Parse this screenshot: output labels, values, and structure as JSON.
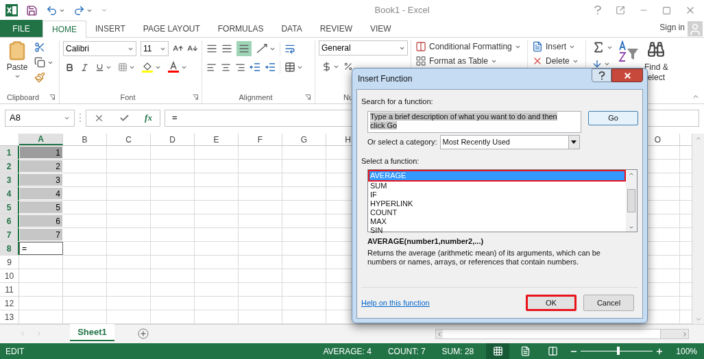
{
  "window": {
    "title": "Book1 - Excel"
  },
  "ribbon_tabs": [
    {
      "label": "FILE",
      "kind": "file",
      "selected": false
    },
    {
      "label": "HOME",
      "kind": "tab",
      "selected": true
    },
    {
      "label": "INSERT",
      "kind": "tab",
      "selected": false
    },
    {
      "label": "PAGE LAYOUT",
      "kind": "tab",
      "selected": false
    },
    {
      "label": "FORMULAS",
      "kind": "tab",
      "selected": false
    },
    {
      "label": "DATA",
      "kind": "tab",
      "selected": false
    },
    {
      "label": "REVIEW",
      "kind": "tab",
      "selected": false
    },
    {
      "label": "VIEW",
      "kind": "tab",
      "selected": false
    }
  ],
  "sign_in": "Sign in",
  "ribbon": {
    "paste": "Paste",
    "font_name": "Calibri",
    "font_size": "11",
    "number_format": "General",
    "conditional_formatting": "Conditional Formatting",
    "format_as_table": "Format as Table",
    "insert": "Insert",
    "delete": "Delete",
    "find_select_line_1": "Find &",
    "find_select_line_2": "elect",
    "group_labels": [
      "Clipboard",
      "Font",
      "Alignment",
      "Nu"
    ]
  },
  "formula_bar": {
    "name_box": "A8",
    "function_label": "fx",
    "formula": "="
  },
  "sheet": {
    "columns": [
      {
        "label": "A",
        "selected": true
      },
      {
        "label": "B",
        "selected": false
      },
      {
        "label": "C",
        "selected": false
      },
      {
        "label": "D",
        "selected": false
      },
      {
        "label": "E",
        "selected": false
      },
      {
        "label": "F",
        "selected": false
      },
      {
        "label": "G",
        "selected": false
      },
      {
        "label": "H",
        "selected": false
      }
    ],
    "last_column": {
      "label": "O"
    },
    "rows": [
      {
        "label": "1",
        "selected": true,
        "in_range": true,
        "range_anchor": true,
        "active": false,
        "cell": "1"
      },
      {
        "label": "2",
        "selected": true,
        "in_range": true,
        "range_anchor": false,
        "active": false,
        "cell": "2"
      },
      {
        "label": "3",
        "selected": true,
        "in_range": true,
        "range_anchor": false,
        "active": false,
        "cell": "3"
      },
      {
        "label": "4",
        "selected": true,
        "in_range": true,
        "range_anchor": false,
        "active": false,
        "cell": "4"
      },
      {
        "label": "5",
        "selected": true,
        "in_range": true,
        "range_anchor": false,
        "active": false,
        "cell": "5"
      },
      {
        "label": "6",
        "selected": true,
        "in_range": true,
        "range_anchor": false,
        "active": false,
        "cell": "6"
      },
      {
        "label": "7",
        "selected": true,
        "in_range": true,
        "range_anchor": false,
        "active": false,
        "cell": "7"
      },
      {
        "label": "8",
        "selected": true,
        "in_range": false,
        "range_anchor": false,
        "active": true,
        "cell": "="
      },
      {
        "label": "9",
        "selected": false,
        "in_range": false,
        "range_anchor": false,
        "active": false
      },
      {
        "label": "10",
        "selected": false,
        "in_range": false,
        "range_anchor": false,
        "active": false
      },
      {
        "label": "11",
        "selected": false,
        "in_range": false,
        "range_anchor": false,
        "active": false
      },
      {
        "label": "12",
        "selected": false,
        "in_range": false,
        "range_anchor": false,
        "active": false
      },
      {
        "label": "13",
        "selected": false,
        "in_range": false,
        "range_anchor": false,
        "active": false
      }
    ]
  },
  "dialog": {
    "title": "Insert Function",
    "search_label": "Search for a function:",
    "search_value": "Type a brief description of what you want to do and then click Go",
    "go_button": "Go",
    "category_label": "Or select a category:",
    "category_value": "Most Recently Used",
    "function_label": "Select a function:",
    "functions": [
      {
        "name": "AVERAGE",
        "selected": true,
        "annotated": true
      },
      {
        "name": "SUM",
        "selected": false,
        "annotated": false
      },
      {
        "name": "IF",
        "selected": false,
        "annotated": false
      },
      {
        "name": "HYPERLINK",
        "selected": false,
        "annotated": false
      },
      {
        "name": "COUNT",
        "selected": false,
        "annotated": false
      },
      {
        "name": "MAX",
        "selected": false,
        "annotated": false
      },
      {
        "name": "SIN",
        "selected": false,
        "annotated": false
      }
    ],
    "signature": "AVERAGE(number1,number2,...)",
    "description": "Returns the average (arithmetic mean) of its arguments, which can be numbers or names, arrays, or references that contain numbers.",
    "help_link": "Help on this function",
    "buttons": [
      {
        "label": "OK",
        "annotated": true
      },
      {
        "label": "Cancel",
        "annotated": false
      }
    ]
  },
  "sheet_tabs": [
    {
      "label": "Sheet1",
      "selected": true
    }
  ],
  "status_bar": {
    "mode": "EDIT",
    "stats": [
      "AVERAGE: 4",
      "COUNT: 7",
      "SUM: 28"
    ],
    "views": [
      {
        "kind": "normal",
        "selected": true
      },
      {
        "kind": "page_layout",
        "selected": false
      },
      {
        "kind": "page_break",
        "selected": false
      }
    ],
    "zoom": {
      "level": 0.52,
      "reading": "100%"
    }
  }
}
